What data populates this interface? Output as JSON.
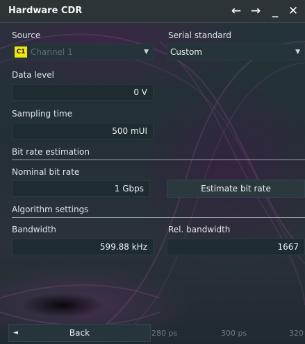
{
  "window": {
    "title": "Hardware CDR"
  },
  "titlebar_icons": [
    "arrow-left-icon",
    "arrow-right-icon",
    "minimize-icon",
    "close-icon"
  ],
  "source": {
    "label": "Source",
    "badge": "C1",
    "value": "Channel 1"
  },
  "serial_standard": {
    "label": "Serial standard",
    "value": "Custom"
  },
  "data_level": {
    "label": "Data level",
    "value": "0 V"
  },
  "sampling_time": {
    "label": "Sampling time",
    "value": "500 mUI"
  },
  "bit_rate_estimation": {
    "title": "Bit rate estimation",
    "nominal_label": "Nominal bit rate",
    "nominal_value": "1 Gbps",
    "estimate_button": "Estimate bit rate"
  },
  "algorithm_settings": {
    "title": "Algorithm settings",
    "bandwidth_label": "Bandwidth",
    "bandwidth_value": "599.88 kHz",
    "rel_bandwidth_label": "Rel. bandwidth",
    "rel_bandwidth_value": "1667"
  },
  "footer": {
    "back_label": "Back",
    "axis_labels": [
      "280 ps",
      "300 ps",
      "320"
    ]
  },
  "colors": {
    "accent_badge": "#f2e312",
    "panel_bg": "#1e2b31",
    "titlebar_bg": "#2c3438"
  }
}
